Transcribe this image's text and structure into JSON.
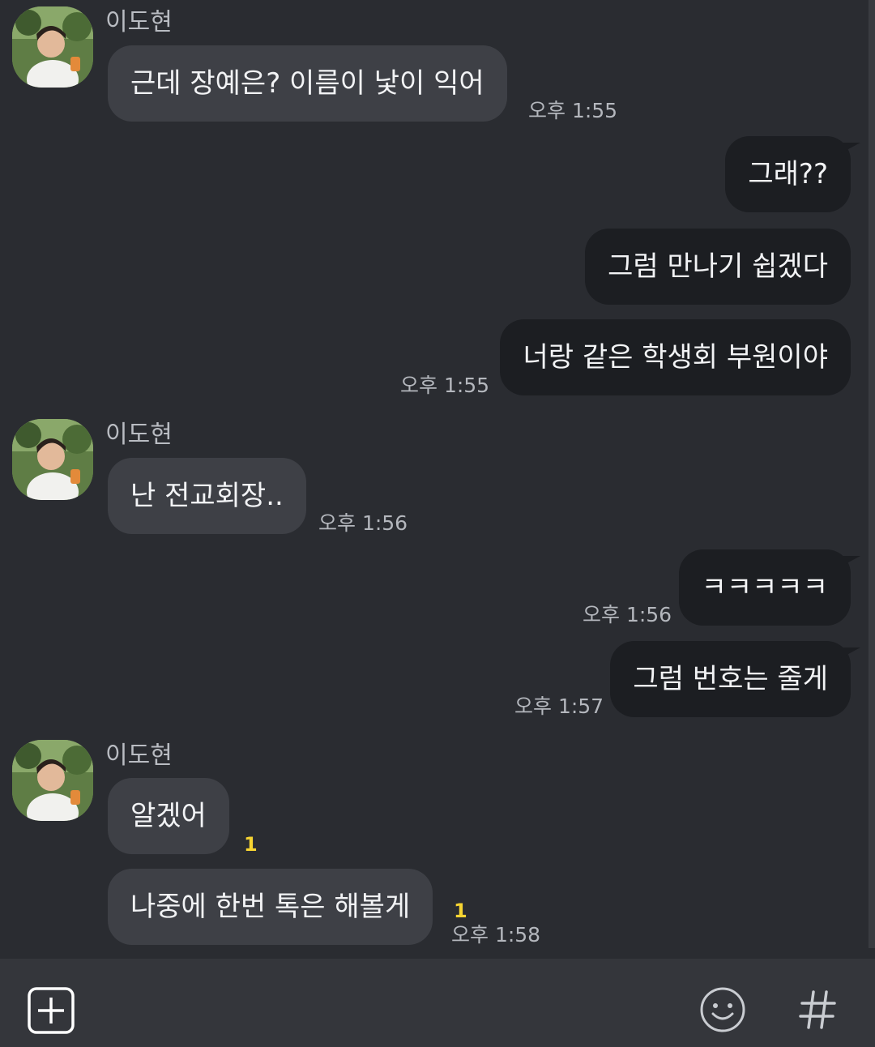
{
  "chat": {
    "groups": [
      {
        "sender": "이도현",
        "messages": [
          {
            "text": "근데 장예은? 이름이 낯이 익어",
            "time": "오후 1:55"
          }
        ]
      },
      {
        "sender": "",
        "messages": [
          {
            "text": "그래??"
          },
          {
            "text": "그럼 만나기 쉽겠다"
          },
          {
            "text": "너랑 같은 학생회 부원이야",
            "time": "오후 1:55"
          }
        ]
      },
      {
        "sender": "이도현",
        "messages": [
          {
            "text": "난 전교회장..",
            "time": "오후 1:56"
          }
        ]
      },
      {
        "sender": "",
        "messages": [
          {
            "text": "ㅋㅋㅋㅋㅋ",
            "time": "오후 1:56"
          },
          {
            "text": "그럼 번호는 줄게",
            "time": "오후 1:57"
          }
        ]
      },
      {
        "sender": "이도현",
        "messages": [
          {
            "text": "알겠어",
            "unread": "1"
          },
          {
            "text": "나중에 한번 톡은 해볼게",
            "unread": "1",
            "time": "오후 1:58"
          }
        ]
      }
    ]
  },
  "input_bar": {
    "icons": [
      "plus-icon",
      "emoji-icon",
      "hashtag-icon"
    ]
  },
  "colors": {
    "background": "#2a2c31",
    "incoming_bubble": "#3e4046",
    "outgoing_bubble": "#1c1e22",
    "unread": "#f6d432"
  }
}
